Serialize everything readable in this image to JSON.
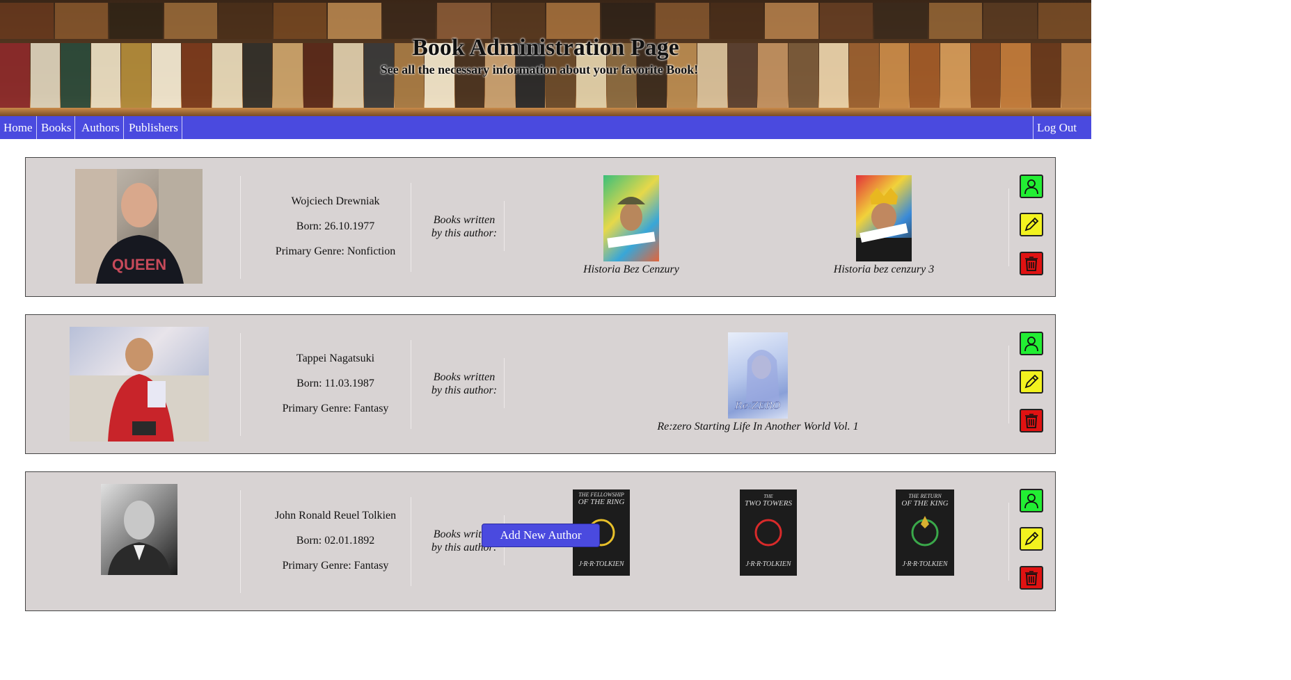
{
  "header": {
    "title": "Book Administration Page",
    "subtitle": "See all the necessary information about your favorite Book!"
  },
  "nav": {
    "items": [
      {
        "label": "Home"
      },
      {
        "label": "Books"
      },
      {
        "label": "Authors"
      },
      {
        "label": "Publishers"
      }
    ],
    "logout": "Log Out"
  },
  "authors": [
    {
      "name": "Wojciech Drewniak",
      "born": "Born: 26.10.1977",
      "genre": "Primary Genre: Nonfiction",
      "books_label_1": "Books written",
      "books_label_2": "by this author:",
      "books": [
        {
          "title": "Historia Bez Cenzury"
        },
        {
          "title": "Historia bez cenzury 3"
        }
      ]
    },
    {
      "name": "Tappei Nagatsuki",
      "born": "Born: 11.03.1987",
      "genre": "Primary Genre: Fantasy",
      "books_label_1": "Books written",
      "books_label_2": "by this author:",
      "books": [
        {
          "title": "Re:zero Starting Life In Another World Vol. 1",
          "cover_text": "Re:ZERO"
        }
      ]
    },
    {
      "name": "John Ronald Reuel Tolkien",
      "born": "Born: 02.01.1892",
      "genre": "Primary Genre: Fantasy",
      "books_label_1": "Books written",
      "books_label_2": "by this author:",
      "books": [
        {
          "cover_title_1": "THE FELLOWSHIP",
          "cover_title_2": "OF THE RING",
          "cover_author": "J·R·R·TOLKIEN"
        },
        {
          "cover_title_1": "THE",
          "cover_title_2": "TWO TOWERS",
          "cover_author": "J·R·R·TOLKIEN"
        },
        {
          "cover_title_1": "THE RETURN",
          "cover_title_2": "OF THE KING",
          "cover_author": "J·R·R·TOLKIEN"
        }
      ]
    }
  ],
  "actions": {
    "view_icon": "person-icon",
    "edit_icon": "pencil-icon",
    "delete_icon": "trash-icon"
  },
  "add_button": "Add New Author",
  "colors": {
    "nav": "#4a4adf",
    "card": "#d8d3d3",
    "view": "#22ee33",
    "edit": "#f2f21f",
    "delete": "#e01212"
  }
}
